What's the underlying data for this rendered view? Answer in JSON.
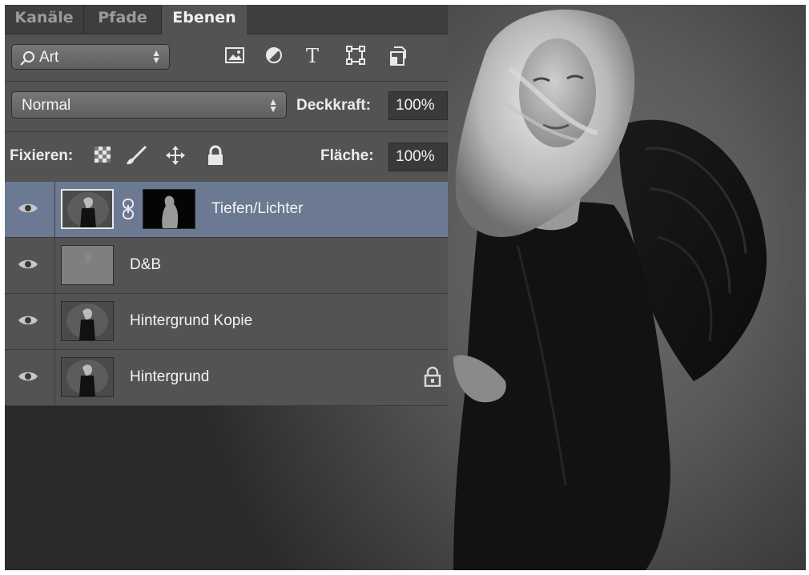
{
  "panel": {
    "tabs": [
      {
        "label": "Kanäle",
        "active": false
      },
      {
        "label": "Pfade",
        "active": false
      },
      {
        "label": "Ebenen",
        "active": true
      }
    ],
    "filter": {
      "kind_label": "Art",
      "icons": [
        "image-filter-icon",
        "adjustment-filter-icon",
        "type-filter-icon",
        "shape-filter-icon",
        "smart-object-filter-icon"
      ]
    },
    "blend": {
      "mode": "Normal",
      "opacity_label": "Deckkraft:",
      "opacity_value": "100%"
    },
    "lock": {
      "label": "Fixieren:",
      "icons": [
        "lock-transparency-icon",
        "lock-pixels-icon",
        "lock-position-icon",
        "lock-all-icon"
      ],
      "fill_label": "Fläche:",
      "fill_value": "100%"
    },
    "layers": [
      {
        "name": "Tiefen/Lichter",
        "selected": true,
        "has_mask": true,
        "locked": false
      },
      {
        "name": "D&B",
        "selected": false,
        "has_mask": false,
        "locked": false
      },
      {
        "name": "Hintergrund Kopie",
        "selected": false,
        "has_mask": false,
        "locked": false
      },
      {
        "name": "Hintergrund",
        "selected": false,
        "has_mask": false,
        "locked": true
      }
    ]
  },
  "colors": {
    "panel_bg": "#535353",
    "tab_bar_bg": "#3e3e3e",
    "selected_layer": "#6b7a92",
    "text": "#f4f4f4"
  }
}
